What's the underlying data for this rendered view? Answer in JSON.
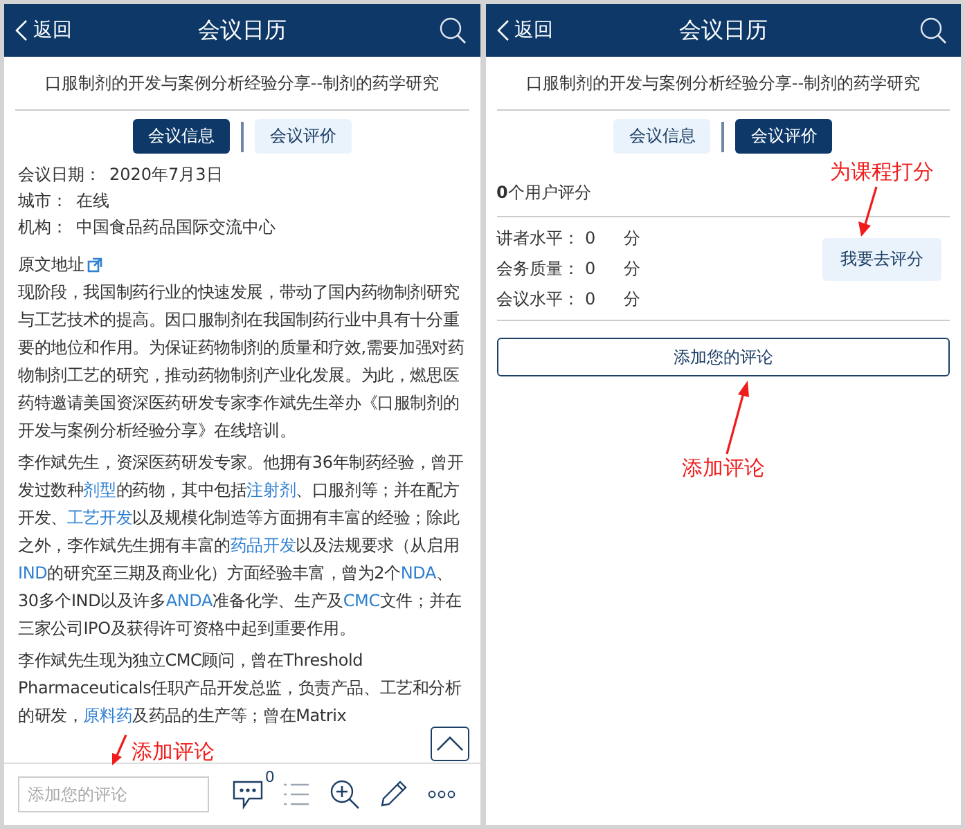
{
  "panels": [
    {
      "header": {
        "back": "返回",
        "title": "会议日历"
      },
      "meeting_title": "口服制剂的开发与案例分析经验分享--制剂的药学研究",
      "tabs": [
        {
          "label": "会议信息",
          "selected": true
        },
        {
          "label": "会议评价",
          "selected": false
        }
      ],
      "kind": "info",
      "details": [
        {
          "label": "会议日期：",
          "value": "2020年7月3日"
        },
        {
          "label": "城市：",
          "value": "在线"
        },
        {
          "label": "机构：",
          "value": "中国食品药品国际交流中心"
        }
      ],
      "source_link": "原文地址",
      "paragraphs": [
        [
          {
            "text": "现阶段，我国制药行业的快速发展，带动了国内药物制剂研究与工艺技术的提高。因口服制剂在我国制药行业中具有十分重要的地位和作用。为保证药物制剂的质量和疗效,需要加强对药物制剂工艺的研究，推动药物制剂产业化发展。为此，燃思医药特邀请美国资深医药研发专家李作斌先生举办《口服制剂的开发与案例分析经验分享》在线培训。",
            "kind": "text"
          }
        ],
        [
          {
            "text": "李作斌先生，资深医药研发专家。他拥有36年制药经验，曾开发过数种",
            "kind": "text"
          },
          {
            "text": "剂型",
            "kind": "link"
          },
          {
            "text": "的药物，其中包括",
            "kind": "text"
          },
          {
            "text": "注射剂",
            "kind": "link"
          },
          {
            "text": "、口服剂等；并在配方开发、",
            "kind": "text"
          },
          {
            "text": "工艺开发",
            "kind": "link"
          },
          {
            "text": "以及规模化制造等方面拥有丰富的经验；除此之外，李作斌先生拥有丰富的",
            "kind": "text"
          },
          {
            "text": "药品开发",
            "kind": "link"
          },
          {
            "text": "以及法规要求（从启用",
            "kind": "text"
          },
          {
            "text": "IND",
            "kind": "link"
          },
          {
            "text": "的研究至三期及商业化）方面经验丰富，曾为2个",
            "kind": "text"
          },
          {
            "text": "NDA",
            "kind": "link"
          },
          {
            "text": "、30多个IND以及许多",
            "kind": "text"
          },
          {
            "text": "ANDA",
            "kind": "link"
          },
          {
            "text": "准备化学、生产及",
            "kind": "text"
          },
          {
            "text": "CMC",
            "kind": "link"
          },
          {
            "text": "文件；并在三家公司IPO及获得许可资格中起到重要作用。",
            "kind": "text"
          }
        ],
        [
          {
            "text": "李作斌先生现为独立CMC顾问，曾在Threshold Pharmaceuticals任职产品开发总监，负责产品、工艺和分析的研发，",
            "kind": "text"
          },
          {
            "text": "原料药",
            "kind": "link"
          },
          {
            "text": "及药品的生产等；曾在Matrix",
            "kind": "text"
          }
        ]
      ],
      "comment_placeholder": "添加您的评论",
      "comment_count": "0",
      "annotation": "添加评论"
    },
    {
      "header": {
        "back": "返回",
        "title": "会议日历"
      },
      "meeting_title": "口服制剂的开发与案例分析经验分享--制剂的药学研究",
      "tabs": [
        {
          "label": "会议信息",
          "selected": false
        },
        {
          "label": "会议评价",
          "selected": true
        }
      ],
      "kind": "rating",
      "rating_count": "**0**个用户评分",
      "ratings": [
        {
          "label": "讲者水平：",
          "value": "0",
          "unit": "分"
        },
        {
          "label": "会务质量：",
          "value": "0",
          "unit": "分"
        },
        {
          "label": "会议水平：",
          "value": "0",
          "unit": "分"
        }
      ],
      "rate_button": "我要去评分",
      "rate_annotation": "为课程打分",
      "add_comment_button": "添加您的评论",
      "annotation": "添加评论"
    }
  ]
}
